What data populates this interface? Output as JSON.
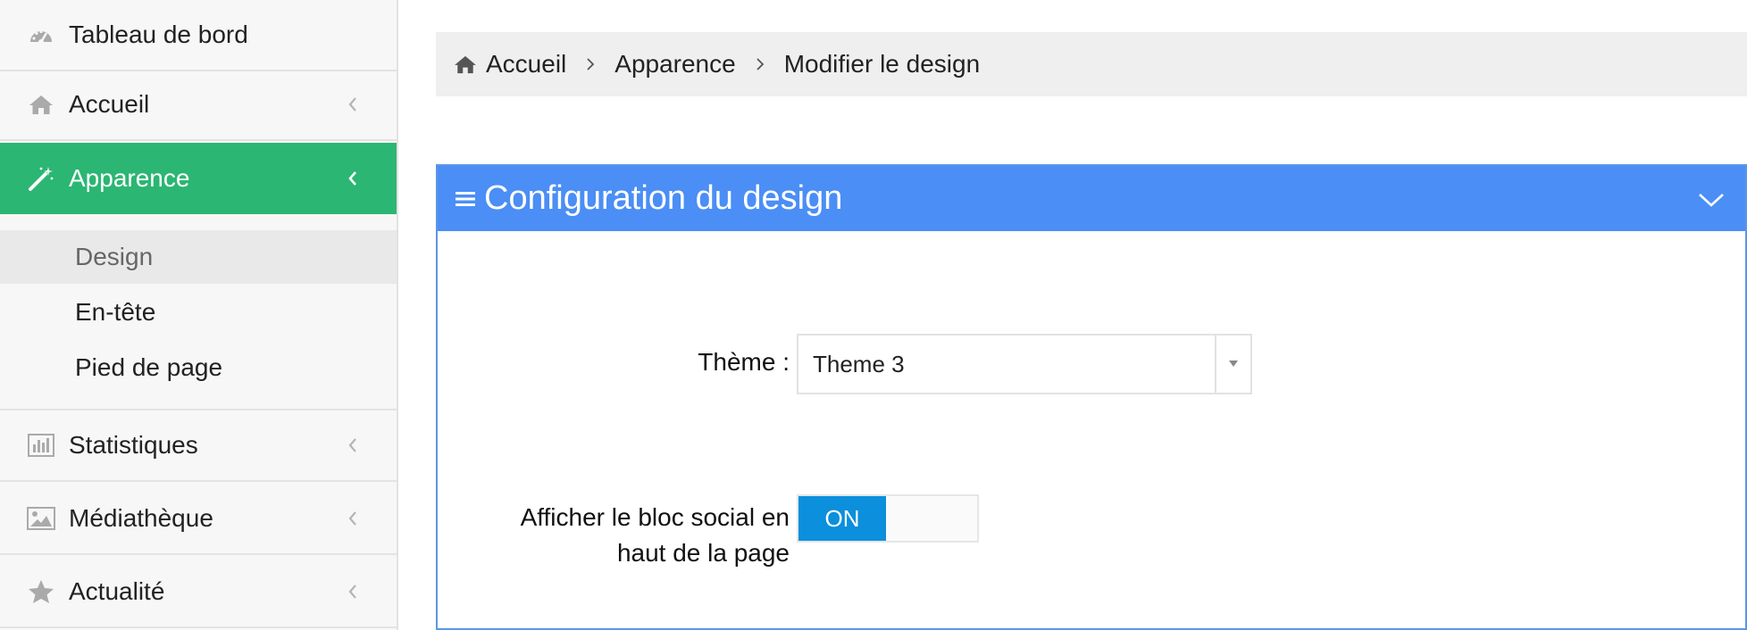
{
  "sidebar": {
    "items": [
      {
        "label": "Tableau de bord",
        "icon": "dashboard-icon"
      },
      {
        "label": "Accueil",
        "icon": "home-icon"
      },
      {
        "label": "Apparence",
        "icon": "magic-wand-icon",
        "active": true
      },
      {
        "label": "Statistiques",
        "icon": "bar-chart-icon"
      },
      {
        "label": "Médiathèque",
        "icon": "image-icon"
      },
      {
        "label": "Actualité",
        "icon": "star-icon"
      }
    ],
    "submenu": [
      {
        "label": "Design",
        "active": true
      },
      {
        "label": "En-tête"
      },
      {
        "label": "Pied de page"
      }
    ],
    "active_color": "#2bb673"
  },
  "breadcrumb": {
    "home": "Accueil",
    "section": "Apparence",
    "current": "Modifier le design"
  },
  "panel": {
    "title": "Configuration du design",
    "header_color": "#4b8ef5",
    "theme_label": "Thème :",
    "theme_value": "Theme 3",
    "social_label_line1": "Afficher le bloc social en",
    "social_label_line2": "haut de la page",
    "toggle_on_label": "ON",
    "toggle_state": true,
    "toggle_color": "#0c8fdc"
  }
}
